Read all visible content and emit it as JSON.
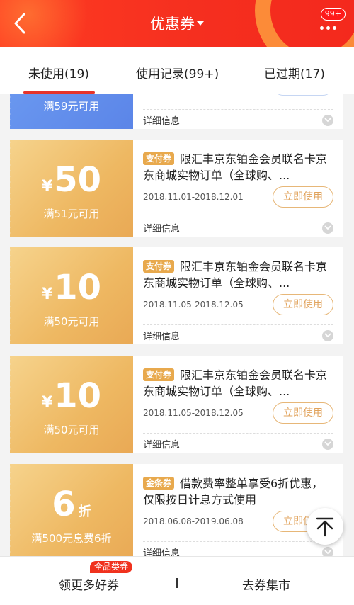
{
  "header": {
    "title": "优惠券",
    "badge": "99+"
  },
  "tabs": [
    {
      "label": "未使用(19)",
      "active": true
    },
    {
      "label": "使用记录(99+)"
    },
    {
      "label": "已过期(17)"
    }
  ],
  "coupons": [
    {
      "currency": "",
      "amount": "",
      "unit": "",
      "condition": "满59元可用",
      "tag": "",
      "desc": "",
      "date": "",
      "button": "",
      "detail": "详细信息",
      "style": "blue"
    },
    {
      "currency": "¥",
      "amount": "50",
      "unit": "",
      "condition": "满51元可用",
      "tag": "支付券",
      "desc": "限汇丰京东铂金会员联名卡京东商城实物订单（全球购、...",
      "date": "2018.11.01-2018.12.01",
      "button": "立即使用",
      "detail": "详细信息"
    },
    {
      "currency": "¥",
      "amount": "10",
      "unit": "",
      "condition": "满50元可用",
      "tag": "支付券",
      "desc": "限汇丰京东铂金会员联名卡京东商城实物订单（全球购、...",
      "date": "2018.11.05-2018.12.05",
      "button": "立即使用",
      "detail": "详细信息"
    },
    {
      "currency": "¥",
      "amount": "10",
      "unit": "",
      "condition": "满50元可用",
      "tag": "支付券",
      "desc": "限汇丰京东铂金会员联名卡京东商城实物订单（全球购、...",
      "date": "2018.11.05-2018.12.05",
      "button": "立即使用",
      "detail": "详细信息"
    },
    {
      "currency": "",
      "amount": "6",
      "unit": "折",
      "condition": "满500元息费6折",
      "tag": "金条券",
      "desc": "借款费率整单享受6折优惠，仅限按日计息方式使用",
      "date": "2018.06.08-2019.06.08",
      "button": "立即使用",
      "detail": "详细信息"
    }
  ],
  "bottom": {
    "left_label": "领更多好券",
    "badge": "全品类券",
    "separator": "I",
    "right_label": "去券集市"
  },
  "colors": {
    "header_red": "#f4291d",
    "tab_underline": "#e6332a",
    "coupon_gold": "#eeb862",
    "coupon_blue": "#5b85e8",
    "button_text": "#e1a35c"
  },
  "icons": {
    "back": "chevron-left-icon",
    "more": "more-dots-icon",
    "detail_toggle": "chevron-down-icon",
    "back_to_top": "back-to-top-icon"
  }
}
